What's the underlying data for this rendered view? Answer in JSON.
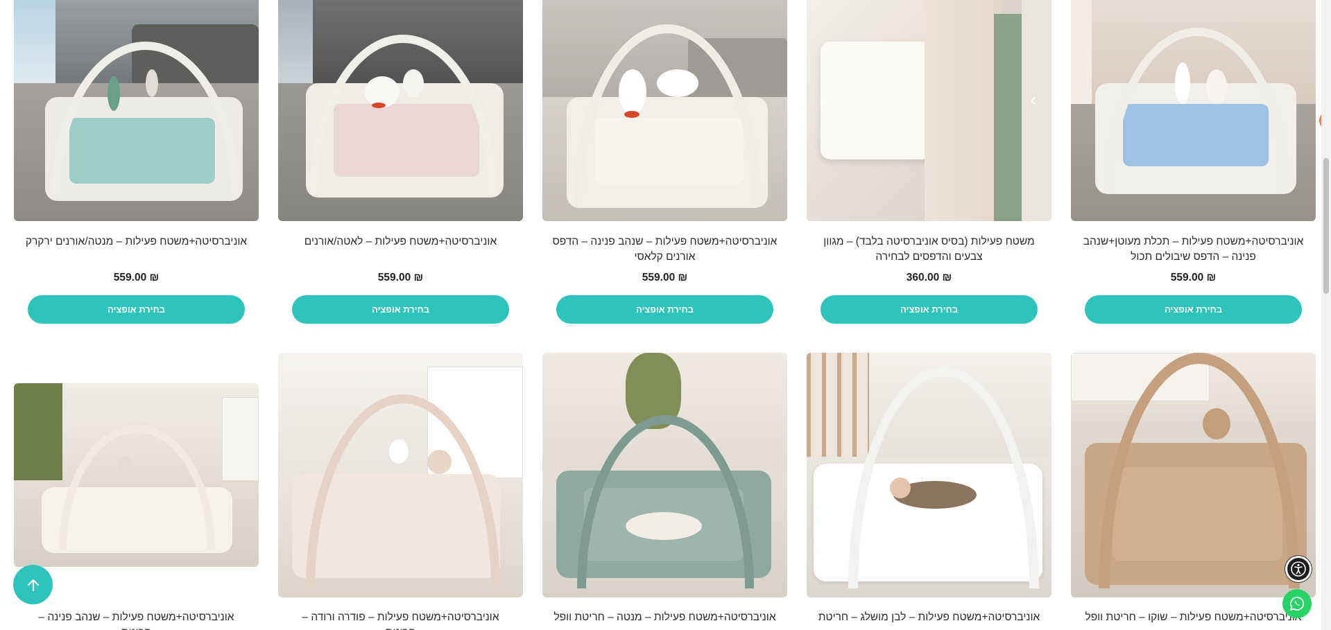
{
  "products_row1": [
    {
      "title": "אוניברסיטה+משטח פעילות – מנטה/אורנים ירקרק",
      "price": "₪ 559.00",
      "button": "בחירת אופציה"
    },
    {
      "title": "אוניברסיטה+משטח פעילות – לאטה/אורנים",
      "price": "₪ 559.00",
      "button": "בחירת אופציה"
    },
    {
      "title": "אוניברסיטה+משטח פעילות – שנהב פנינה – הדפס אורנים קלאסי",
      "price": "₪ 559.00",
      "button": "בחירת אופציה"
    },
    {
      "title": "משטח פעילות (בסיס אוניברסיטה בלבד) – מגוון צבעים והדפסים לבחירה",
      "price": "₪ 360.00",
      "button": "בחירת אופציה"
    },
    {
      "title": "אוניברסיטה+משטח פעילות – תכלת מעוטן+שנהב פנינה – הדפס שיבולים תכול",
      "price": "₪ 559.00",
      "button": "בחירת אופציה"
    }
  ],
  "products_row2": [
    {
      "title": "אוניברסיטה+משטח פעילות – שנהב פנינה – חריטת"
    },
    {
      "title": "אוניברסיטה+משטח פעילות – פודרה ורודה – חריטת"
    },
    {
      "title": "אוניברסיטה+משטח פעילות – מנטה – חריטת וופל"
    },
    {
      "title": "אוניברסיטה+משטח פעילות – לבן מושלג – חריטת"
    },
    {
      "title": "אוניברסיטה+משטח פעילות – שוקו – חריטת וופל"
    }
  ],
  "carousel": {
    "prev_icon": "‹",
    "next_icon": "›"
  },
  "colors": {
    "accent": "#2cc4bd",
    "whatsapp": "#25d366"
  }
}
